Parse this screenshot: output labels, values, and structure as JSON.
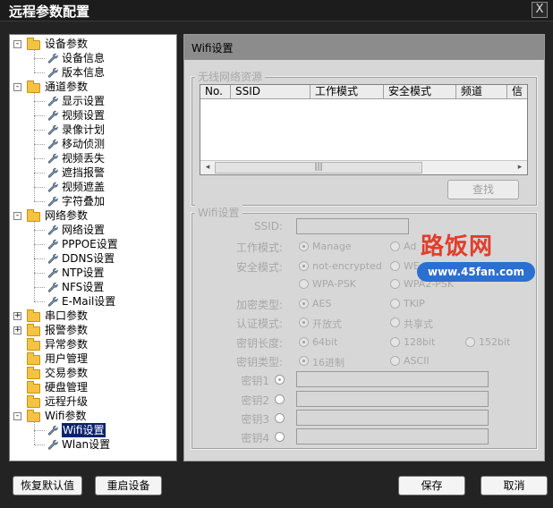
{
  "window": {
    "title": "远程参数配置",
    "close_glyph": "X"
  },
  "tree": [
    {
      "id": "shebei",
      "label": "设备参数",
      "level": 0,
      "expander": "-",
      "children": [
        {
          "label": "设备信息"
        },
        {
          "label": "版本信息"
        }
      ]
    },
    {
      "id": "tongdao",
      "label": "通道参数",
      "level": 0,
      "expander": "-",
      "children": [
        {
          "label": "显示设置"
        },
        {
          "label": "视频设置"
        },
        {
          "label": "录像计划"
        },
        {
          "label": "移动侦测"
        },
        {
          "label": "视频丢失"
        },
        {
          "label": "遮挡报警"
        },
        {
          "label": "视频遮盖"
        },
        {
          "label": "字符叠加"
        }
      ]
    },
    {
      "id": "wangluo",
      "label": "网络参数",
      "level": 0,
      "expander": "-",
      "children": [
        {
          "label": "网络设置"
        },
        {
          "label": "PPPOE设置"
        },
        {
          "label": "DDNS设置"
        },
        {
          "label": "NTP设置"
        },
        {
          "label": "NFS设置"
        },
        {
          "label": "E-Mail设置"
        }
      ]
    },
    {
      "id": "chuankou",
      "label": "串口参数",
      "level": 0,
      "expander": "+"
    },
    {
      "id": "baojing",
      "label": "报警参数",
      "level": 0,
      "expander": "+"
    },
    {
      "id": "yichang",
      "label": "异常参数",
      "level": 0
    },
    {
      "id": "yonghu",
      "label": "用户管理",
      "level": 0
    },
    {
      "id": "jiaoyi",
      "label": "交易参数",
      "level": 0
    },
    {
      "id": "yingpan",
      "label": "硬盘管理",
      "level": 0
    },
    {
      "id": "shengji",
      "label": "远程升级",
      "level": 0
    },
    {
      "id": "wifi",
      "label": "Wifi参数",
      "level": 0,
      "expander": "-",
      "children": [
        {
          "label": "Wifi设置",
          "selected": true
        },
        {
          "label": "Wlan设置"
        }
      ]
    }
  ],
  "content": {
    "header": "Wifi设置",
    "wireless_group": {
      "legend": "无线网络资源",
      "columns": [
        "No.",
        "SSID",
        "工作模式",
        "安全模式",
        "频道",
        "信"
      ],
      "scroll_left": "◂",
      "scroll_thumb": "|||",
      "scroll_right": "▸",
      "search_button": "查找"
    },
    "wifi_group": {
      "legend": "Wifi设置",
      "ssid_label": "SSID:",
      "work_mode_label": "工作模式:",
      "work_mode_options": [
        "Manage",
        "Ad"
      ],
      "security_mode_label": "安全模式:",
      "security_options": [
        "not-encrypted",
        "WE",
        "WPA-PSK",
        "WPA2-PSK"
      ],
      "encryption_label": "加密类型:",
      "encryption_options": [
        "AES",
        "TKIP"
      ],
      "auth_label": "认证模式:",
      "auth_options": [
        "开放式",
        "共享式"
      ],
      "key_length_label": "密钥长度:",
      "key_length_options": [
        "64bit",
        "128bit",
        "152bit"
      ],
      "key_type_label": "密钥类型:",
      "key_type_options": [
        "16进制",
        "ASCII"
      ],
      "keys": [
        "密钥1",
        "密钥2",
        "密钥3",
        "密钥4"
      ]
    }
  },
  "watermark": {
    "logo": "路饭网",
    "url": "www.45fan.com"
  },
  "buttons": {
    "restore_default": "恢复默认值",
    "restart": "重启设备",
    "save": "保存",
    "cancel": "取消"
  },
  "colors": {
    "tree_selected_bg": "#0a246a",
    "folder": "#f5c342",
    "watermark_red": "#e23d2a",
    "watermark_blue": "#2b6fd1"
  }
}
